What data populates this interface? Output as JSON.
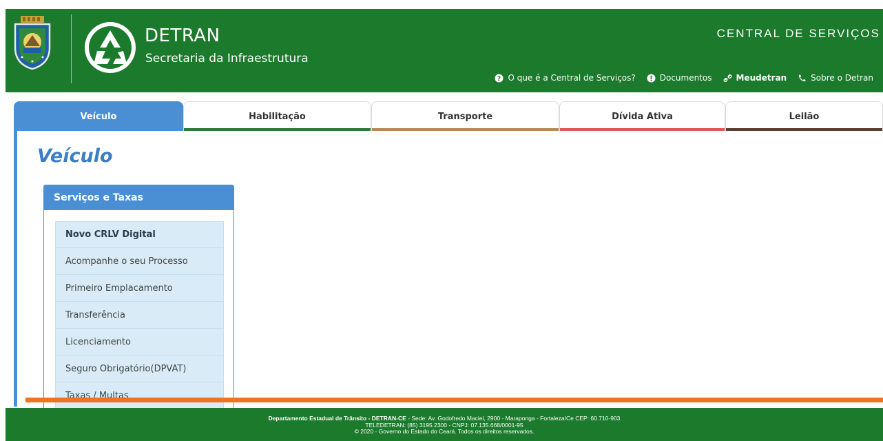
{
  "header": {
    "brand_title": "DETRAN",
    "brand_subtitle": "Secretaria da Infraestrutura",
    "central_label": "CENTRAL DE SERVIÇOS",
    "nav": [
      {
        "label": "O que é a Central de Serviços?",
        "icon": "question-circle-icon",
        "bold": false
      },
      {
        "label": "Documentos",
        "icon": "info-circle-icon",
        "bold": false
      },
      {
        "label": "Meudetran",
        "icon": "link-icon",
        "bold": true
      },
      {
        "label": "Sobre o Detran",
        "icon": "phone-icon",
        "bold": false
      }
    ],
    "color": "#1b7a2b"
  },
  "tabs": [
    {
      "label": "Veículo",
      "accent": "#4a8fd4",
      "active": true
    },
    {
      "label": "Habilitação",
      "accent": "#2f7a3a",
      "active": false
    },
    {
      "label": "Transporte",
      "accent": "#b88a58",
      "active": false
    },
    {
      "label": "Dívida Ativa",
      "accent": "#e05555",
      "active": false
    },
    {
      "label": "Leilão",
      "accent": "#5a4030",
      "active": false
    }
  ],
  "main": {
    "title": "Veículo",
    "panel_title": "Serviços e Taxas",
    "menu": [
      "Novo CRLV Digital",
      "Acompanhe o seu Processo",
      "Primeiro Emplacamento",
      "Transferência",
      "Licenciamento",
      "Seguro Obrigatório(DPVAT)",
      "Taxas / Multas"
    ]
  },
  "footer": {
    "line1_bold": "Departamento Estadual de Trânsito - DETRAN-CE",
    "line1_rest": " - Sede: Av. Godofredo Maciel, 2900 - Maraponga - Fortaleza/Ce CEP: 60.710-903",
    "line2": "TELEDETRAN: (85) 3195.2300 - CNPJ: 07.135.668/0001-95",
    "line3": "© 2020 - Governo do Estado do Ceará. Todos os direitos reservados."
  },
  "colors": {
    "accent_blue": "#4a8fd4",
    "footer_orange": "#ee7322"
  }
}
